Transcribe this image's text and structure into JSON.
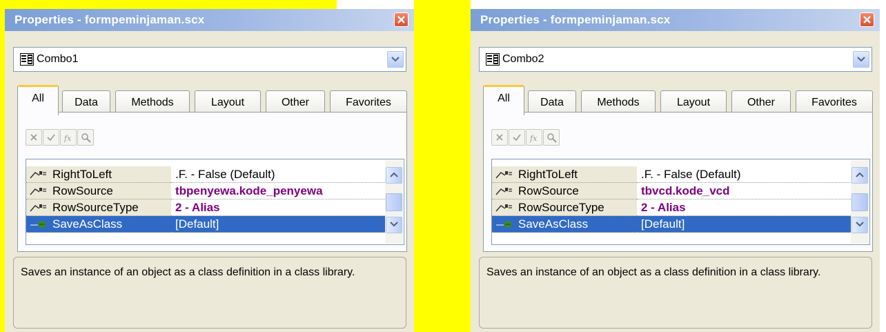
{
  "panels": [
    {
      "title": "Properties - formpeminjaman.scx",
      "object_name": "Combo1",
      "tabs": [
        "All",
        "Data",
        "Methods",
        "Layout",
        "Other",
        "Favorites"
      ],
      "active_tab": "All",
      "rows": [
        {
          "name": "RightToLeft",
          "value": ".F. - False (Default)"
        },
        {
          "name": "RowSource",
          "value": "tbpenyewa.kode_penyewa"
        },
        {
          "name": "RowSourceType",
          "value": "2 - Alias"
        },
        {
          "name": "SaveAsClass",
          "value": "[Default]"
        }
      ],
      "description": "Saves an instance of an object as a class definition in a class library."
    },
    {
      "title": "Properties - formpeminjaman.scx",
      "object_name": "Combo2",
      "tabs": [
        "All",
        "Data",
        "Methods",
        "Layout",
        "Other",
        "Favorites"
      ],
      "active_tab": "All",
      "rows": [
        {
          "name": "RightToLeft",
          "value": ".F. - False (Default)"
        },
        {
          "name": "RowSource",
          "value": "tbvcd.kode_vcd"
        },
        {
          "name": "RowSourceType",
          "value": "2 - Alias"
        },
        {
          "name": "SaveAsClass",
          "value": "[Default]"
        }
      ],
      "description": "Saves an instance of an object as a class definition in a class library."
    }
  ],
  "colors": {
    "highlight_background": "#ffff00",
    "titlebar": "#7b9fd6",
    "selected_row": "#316ac5",
    "modified_value": "#800080",
    "active_tab_accent": "#ffc83c"
  },
  "icons": {
    "close": "close-icon",
    "combo_object": "combobox-object-icon",
    "dropdown": "chevron-down-icon",
    "toolbar": [
      "cancel-icon",
      "accept-icon",
      "function-icon",
      "zoom-icon"
    ],
    "property": "property-icon",
    "method": "method-icon"
  }
}
